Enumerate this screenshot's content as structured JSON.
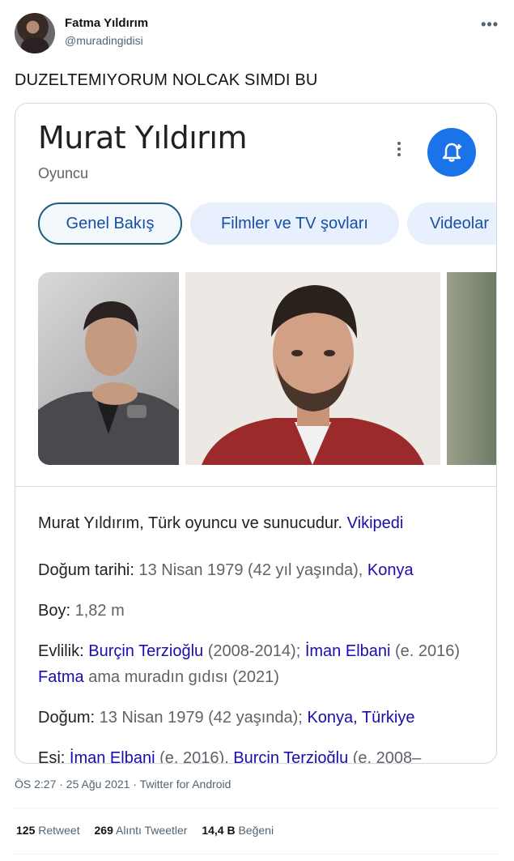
{
  "tweet": {
    "author_name": "Fatma Yıldırım",
    "author_handle": "@muradingidisi",
    "more_label": "•••",
    "text": "DUZELTEMIYORUM NOLCAK SIMDI BU",
    "timestamp": "ÖS 2:27 · 25 Ağu 2021 · Twitter for Android",
    "stats": {
      "retweets_count": "125",
      "retweets_label": "Retweet",
      "quotes_count": "269",
      "quotes_label": "Alıntı Tweetler",
      "likes_count": "14,4 B",
      "likes_label": "Beğeni"
    }
  },
  "knowledge_panel": {
    "title": "Murat Yıldırım",
    "subtitle": "Oyuncu",
    "follow_icon": "bell-plus-icon",
    "tabs": [
      {
        "label": "Genel Bakış"
      },
      {
        "label": "Filmler ve TV şovları"
      },
      {
        "label": "Videolar"
      }
    ],
    "description": "Murat Yıldırım, Türk oyuncu ve sunucudur.",
    "description_source": "Vikipedi",
    "facts": {
      "birth_date_label": "Doğum tarihi:",
      "birth_date_value": "13 Nisan 1979 (42 yıl yaşında),",
      "birth_date_place": "Konya",
      "height_label": "Boy:",
      "height_value": "1,82 m",
      "marriage_label": "Evlilik:",
      "marriage_spouse1": "Burçin Terzioğlu",
      "marriage_spouse1_years": "(2008-2014);",
      "marriage_spouse2": "İman Elbani",
      "marriage_spouse2_years": "(e. 2016)",
      "marriage_spouse3": "Fatma",
      "marriage_spouse3_years": "ama muradın gıdısı (2021)",
      "birth_label": "Doğum:",
      "birth_value": "13 Nisan 1979 (42 yaşında);",
      "birth_place": "Konya, Türkiye",
      "spouse_label": "Eşi:",
      "spouse_1": "İman Elbani",
      "spouse_1_years": "(e. 2016),",
      "spouse_2": "Burçin Terzioğlu",
      "spouse_2_years": "(e. 2008–"
    }
  },
  "colors": {
    "accent_blue": "#1a73e8",
    "link_blue": "#1a0dab",
    "chip_bg": "#e8f0fe"
  }
}
